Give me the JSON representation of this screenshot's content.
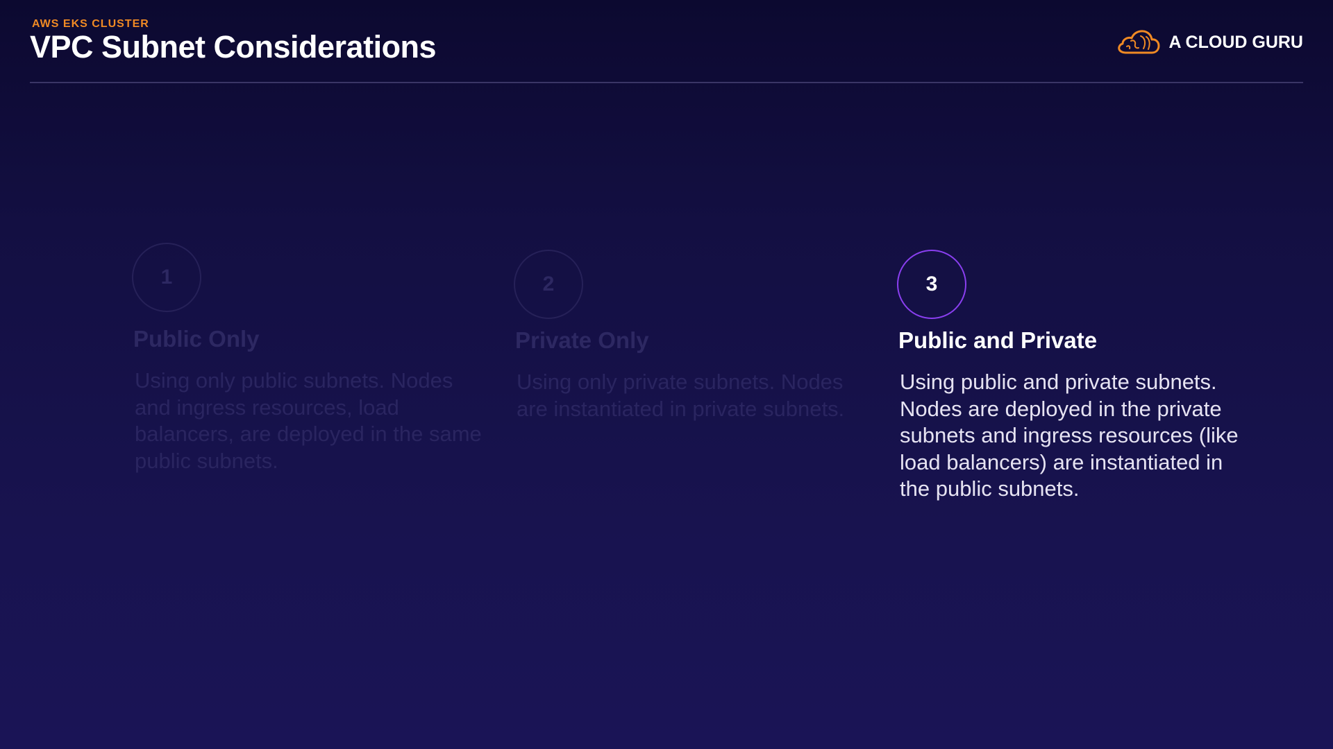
{
  "header": {
    "eyebrow": "AWS EKS CLUSTER",
    "title": "VPC Subnet Considerations",
    "brand_name": "A CLOUD GURU",
    "logo_icon": "cloud-logo-icon"
  },
  "colors": {
    "accent_orange": "#f08a24",
    "active_ring": "#8a3ff0",
    "background": "#18134f"
  },
  "options": [
    {
      "number": "1",
      "heading": "Public Only",
      "body": "Using only public subnets. Nodes and ingress resources, load balancers, are deployed in the same public subnets.",
      "active": false
    },
    {
      "number": "2",
      "heading": "Private Only",
      "body": "Using only private subnets. Nodes are instantiated in private subnets.",
      "active": false
    },
    {
      "number": "3",
      "heading": "Public and Private",
      "body": "Using public and private subnets. Nodes are deployed in the private subnets and ingress resources (like load balancers) are instantiated in the public subnets.",
      "active": true
    }
  ]
}
